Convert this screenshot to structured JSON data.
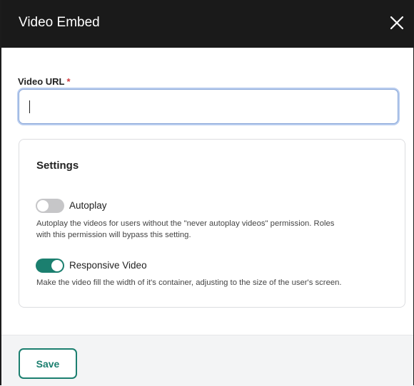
{
  "dialog": {
    "title": "Video Embed",
    "close_icon": "close-icon"
  },
  "url_field": {
    "label": "Video URL",
    "required_marker": "*",
    "value": "",
    "placeholder": ""
  },
  "settings": {
    "title": "Settings",
    "options": [
      {
        "label": "Autoplay",
        "enabled": false,
        "description_lines": [
          "Autoplay the videos for users without the \"never autoplay videos\" permission. Roles",
          "with this permission will bypass this setting."
        ]
      },
      {
        "label": "Responsive Video",
        "enabled": true,
        "description_lines": [
          "Make the video fill the width of it's container, adjusting to the size of the user's screen."
        ]
      }
    ]
  },
  "footer": {
    "save_label": "Save"
  },
  "colors": {
    "header_bg": "#1a1a1a",
    "accent": "#1b7f6f",
    "required": "#d0393d",
    "toggle_off": "#c6c6c8"
  }
}
